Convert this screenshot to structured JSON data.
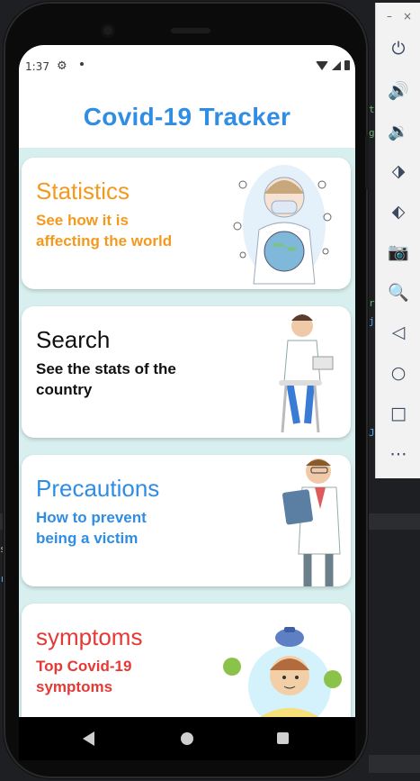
{
  "ide": {
    "code_fragments": [
      "t",
      "g",
      "r",
      "j",
      "J",
      "s",
      "r"
    ]
  },
  "statusbar": {
    "time": "1:37",
    "icons": [
      "settings-icon",
      "notification-dot",
      "wifi-icon",
      "signal-icon",
      "battery-icon"
    ]
  },
  "app": {
    "title": "Covid-19 Tracker",
    "cards": [
      {
        "title": "Statistics",
        "subtitle": "See how it is affecting the world",
        "color": "#f39a1e",
        "icon": "doctor-mask-globe-illustration"
      },
      {
        "title": "Search",
        "subtitle": "See the stats of the country",
        "color": "#111111",
        "icon": "doctor-on-stool-illustration"
      },
      {
        "title": "Precautions",
        "subtitle": "How to prevent being a victim",
        "color": "#2f8de4",
        "icon": "doctor-clipboard-illustration"
      },
      {
        "title": "symptoms",
        "subtitle": "Top Covid-19 symptoms",
        "color": "#e53935",
        "icon": "sick-person-icepack-illustration"
      }
    ]
  },
  "colors": {
    "title": "#2f8de4",
    "list_background": "#d7efee"
  },
  "navbar": {
    "icons": [
      "back-icon",
      "home-icon",
      "recents-icon"
    ]
  },
  "emulator_toolbar": {
    "window_controls": [
      "–",
      "×"
    ],
    "items": [
      "power-icon",
      "volume-up-icon",
      "volume-down-icon",
      "rotate-left-icon",
      "rotate-right-icon",
      "camera-icon",
      "zoom-icon",
      "back-icon",
      "home-icon",
      "overview-icon",
      "more-icon"
    ]
  }
}
